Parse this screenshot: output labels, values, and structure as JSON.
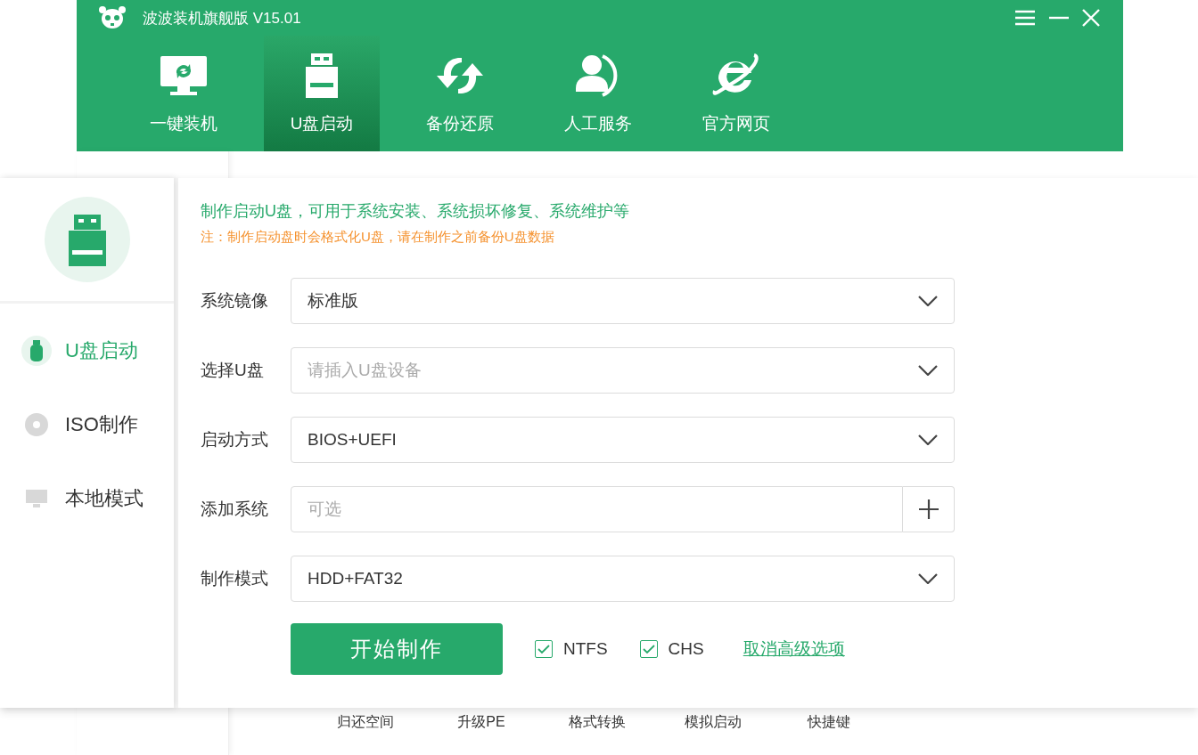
{
  "window": {
    "title": "波波装机旗舰版 V15.01"
  },
  "nav_tabs": [
    {
      "label": "一键装机",
      "selected": false
    },
    {
      "label": "U盘启动",
      "selected": true
    },
    {
      "label": "备份还原",
      "selected": false
    },
    {
      "label": "人工服务",
      "selected": false
    },
    {
      "label": "官方网页",
      "selected": false
    }
  ],
  "toolbar": [
    "归还空间",
    "升级PE",
    "格式转换",
    "模拟启动",
    "快捷键"
  ],
  "dialog": {
    "sidebar": [
      {
        "label": "U盘启动",
        "selected": true
      },
      {
        "label": "ISO制作",
        "selected": false
      },
      {
        "label": "本地模式",
        "selected": false
      }
    ],
    "headline": "制作启动U盘，可用于系统安装、系统损坏修复、系统维护等",
    "note": "注：制作启动盘时会格式化U盘，请在制作之前备份U盘数据",
    "fields": [
      {
        "label": "系统镜像",
        "kind": "dropdown",
        "value": "标准版"
      },
      {
        "label": "选择U盘",
        "kind": "dropdown",
        "placeholder": "请插入U盘设备"
      },
      {
        "label": "启动方式",
        "kind": "dropdown",
        "value": "BIOS+UEFI"
      },
      {
        "label": "添加系统",
        "kind": "add",
        "placeholder": "可选"
      },
      {
        "label": "制作模式",
        "kind": "dropdown",
        "value": "HDD+FAT32"
      }
    ],
    "start_button": "开始制作",
    "options": [
      {
        "label": "NTFS",
        "checked": true
      },
      {
        "label": "CHS",
        "checked": true
      }
    ],
    "advanced_link": "取消高级选项"
  }
}
